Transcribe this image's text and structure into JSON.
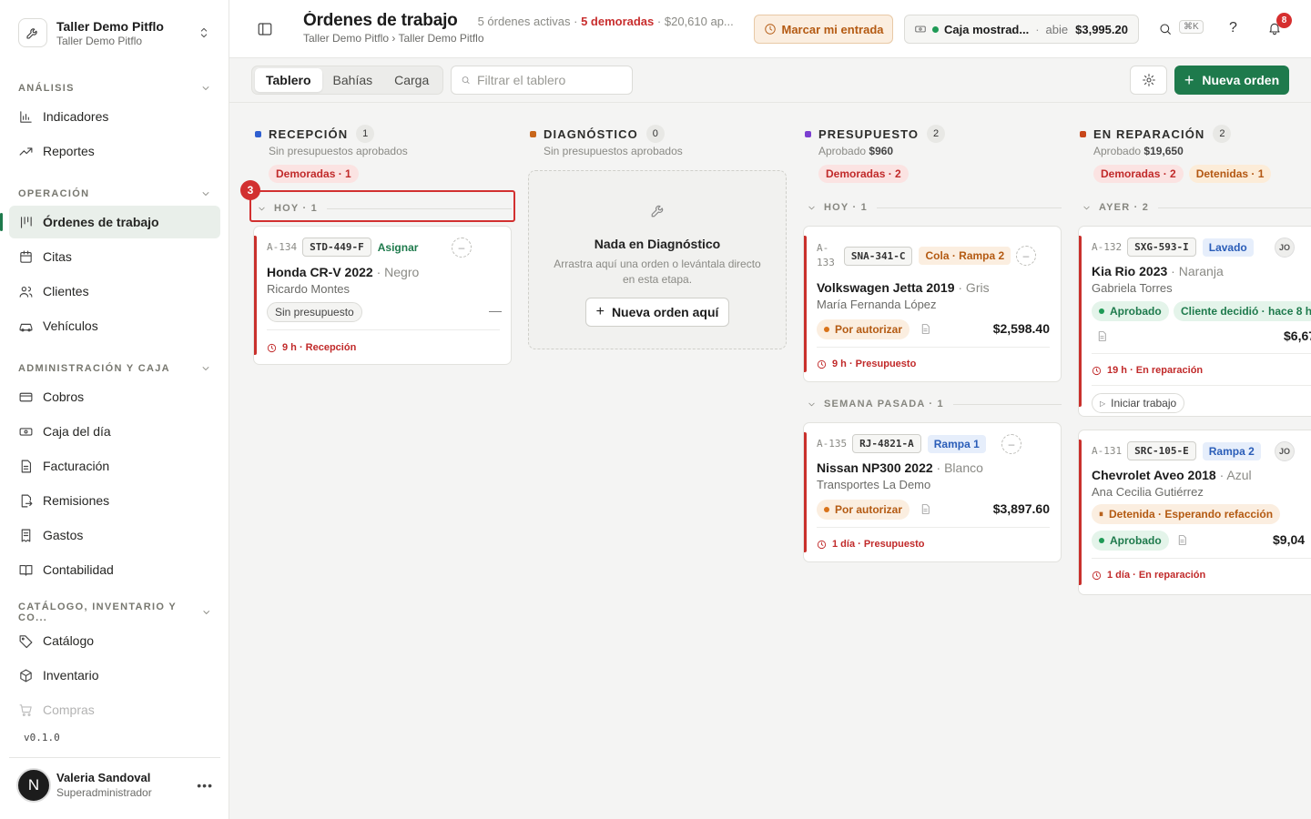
{
  "workspace": {
    "name": "Taller Demo Pitflo",
    "subtitle": "Taller Demo Pitflo"
  },
  "sidebar": {
    "sections": [
      {
        "title": "ANÁLISIS",
        "items": [
          {
            "label": "Indicadores",
            "icon": "chart-bar-icon"
          },
          {
            "label": "Reportes",
            "icon": "trend-icon"
          }
        ]
      },
      {
        "title": "OPERACIÓN",
        "items": [
          {
            "label": "Órdenes de trabajo",
            "icon": "kanban-icon",
            "active": true
          },
          {
            "label": "Citas",
            "icon": "calendar-icon"
          },
          {
            "label": "Clientes",
            "icon": "users-icon"
          },
          {
            "label": "Vehículos",
            "icon": "car-icon"
          }
        ]
      },
      {
        "title": "ADMINISTRACIÓN Y CAJA",
        "items": [
          {
            "label": "Cobros",
            "icon": "card-icon"
          },
          {
            "label": "Caja del día",
            "icon": "cash-icon"
          },
          {
            "label": "Facturación",
            "icon": "document-icon"
          },
          {
            "label": "Remisiones",
            "icon": "file-export-icon"
          },
          {
            "label": "Gastos",
            "icon": "receipt-icon"
          },
          {
            "label": "Contabilidad",
            "icon": "book-icon"
          }
        ]
      },
      {
        "title": "CATÁLOGO, INVENTARIO Y CO...",
        "items": [
          {
            "label": "Catálogo",
            "icon": "tag-icon"
          },
          {
            "label": "Inventario",
            "icon": "box-icon"
          },
          {
            "label": "Compras",
            "icon": "cart-icon"
          }
        ]
      }
    ],
    "version": "v0.1.0",
    "user": {
      "initial": "N",
      "name": "Valeria Sandoval",
      "role": "Superadministrador"
    }
  },
  "header": {
    "title": "Órdenes de trabajo",
    "meta_active": "5 órdenes activas",
    "meta_sep": "·",
    "meta_late": "5 demoradas",
    "meta_amount": "$20,610 ap...",
    "breadcrumb": "Taller Demo Pitflo › Taller Demo Pitflo",
    "entry_button": "Marcar mi entrada",
    "register": {
      "name": "Caja mostrad...",
      "status": "abie",
      "amount": "$3,995.20"
    },
    "shortcut": "⌘K",
    "help": "?",
    "notifications": "8"
  },
  "toolbar": {
    "tabs": [
      "Tablero",
      "Bahías",
      "Carga"
    ],
    "filter_placeholder": "Filtrar el tablero",
    "new_order": "Nueva orden"
  },
  "columns": {
    "recepcion": {
      "title": "RECEPCIÓN",
      "count": "1",
      "subtitle": "Sin presupuestos aprobados",
      "late_pill": "Demoradas · 1",
      "color": "#2f5fd0"
    },
    "diagnostico": {
      "title": "DIAGNÓSTICO",
      "count": "0",
      "subtitle": "Sin presupuestos aprobados",
      "color": "#c8661a"
    },
    "presupuesto": {
      "title": "PRESUPUESTO",
      "count": "2",
      "subtitle_label": "Aprobado",
      "subtitle_value": "$960",
      "late_pill": "Demoradas · 2",
      "color": "#7b3fd0"
    },
    "reparacion": {
      "title": "EN REPARACIÓN",
      "count": "2",
      "subtitle_label": "Aprobado",
      "subtitle_value": "$19,650",
      "late_pill": "Demoradas · 2",
      "hold_pill": "Detenidas · 1",
      "color": "#c8471a"
    }
  },
  "groups": {
    "recepcion_today": "HOY · 1",
    "presupuesto_today": "HOY · 1",
    "presupuesto_lastweek": "SEMANA PASADA · 1",
    "reparacion_yesterday": "AYER · 2"
  },
  "annotation": {
    "badge": "3"
  },
  "empty_diagnostico": {
    "title": "Nada en Diagnóstico",
    "description": "Arrastra aquí una orden o levántala directo en esta etapa.",
    "button": "Nueva orden aquí"
  },
  "cards": {
    "a134": {
      "id": "A-134",
      "plate": "STD-449-F",
      "assign": "Asignar",
      "vehicle": "Honda CR-V 2022",
      "color": "· Negro",
      "customer": "Ricardo Montes",
      "status": "Sin presupuesto",
      "dash": "—",
      "time": "9 h · Recepción"
    },
    "a133": {
      "id": "A-",
      "id2": "133",
      "plate": "SNA-341-C",
      "tag": "Cola · Rampa 2",
      "vehicle": "Volkswagen Jetta 2019",
      "color": "· Gris",
      "customer": "María Fernanda López",
      "status": "Por autorizar",
      "amount": "$2,598.40",
      "time": "9 h · Presupuesto"
    },
    "a135": {
      "id": "A-135",
      "plate": "RJ-4821-A",
      "tag": "Rampa 1",
      "vehicle": "Nissan NP300 2022",
      "color": "· Blanco",
      "customer": "Transportes La Demo",
      "status": "Por autorizar",
      "amount": "$3,897.60",
      "time": "1 día · Presupuesto"
    },
    "a132": {
      "id": "A-132",
      "plate": "SXG-593-I",
      "tag": "Lavado",
      "avatar": "JO",
      "vehicle": "Kia Rio 2023",
      "color": "· Naranja",
      "customer": "Gabriela Torres",
      "status": "Aprobado",
      "client_note": "Cliente decidió · hace 8 h",
      "amount": "$6,67",
      "time": "19 h · En reparación",
      "start": "Iniciar trabajo"
    },
    "a131": {
      "id": "A-131",
      "plate": "SRC-105-E",
      "tag": "Rampa 2",
      "avatar": "JO",
      "vehicle": "Chevrolet Aveo 2018",
      "color": "· Azul",
      "customer": "Ana Cecilia Gutiérrez",
      "hold": "Detenida · Esperando refacción",
      "status": "Aprobado",
      "amount": "$9,04",
      "time": "1 día · En reparación"
    }
  }
}
